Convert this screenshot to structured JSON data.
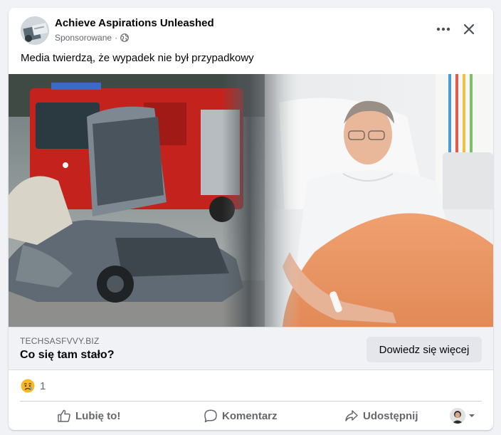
{
  "post": {
    "page_name": "Achieve Aspirations Unleashed",
    "sponsored_label": "Sponsorowane",
    "separator": "·",
    "caption": "Media twierdzą, że wypadek nie był przypadkowy"
  },
  "image": {
    "left_panel": "wrecked car in front of fire truck",
    "right_panel": "man in hospital bed"
  },
  "link_preview": {
    "domain": "TECHSASFVVY.BIZ",
    "title": "Co się tam stało?",
    "cta_label": "Dowiedz się więcej"
  },
  "reactions": {
    "icon": "sad-emoji-icon",
    "count": "1"
  },
  "actions": {
    "like_label": "Lubię to!",
    "comment_label": "Komentarz",
    "share_label": "Udostępnij"
  },
  "colors": {
    "background": "#f0f2f5",
    "card": "#ffffff",
    "secondary_text": "#65676b",
    "button_grey": "#e4e6eb",
    "emoji_yellow": "#f7b928"
  }
}
